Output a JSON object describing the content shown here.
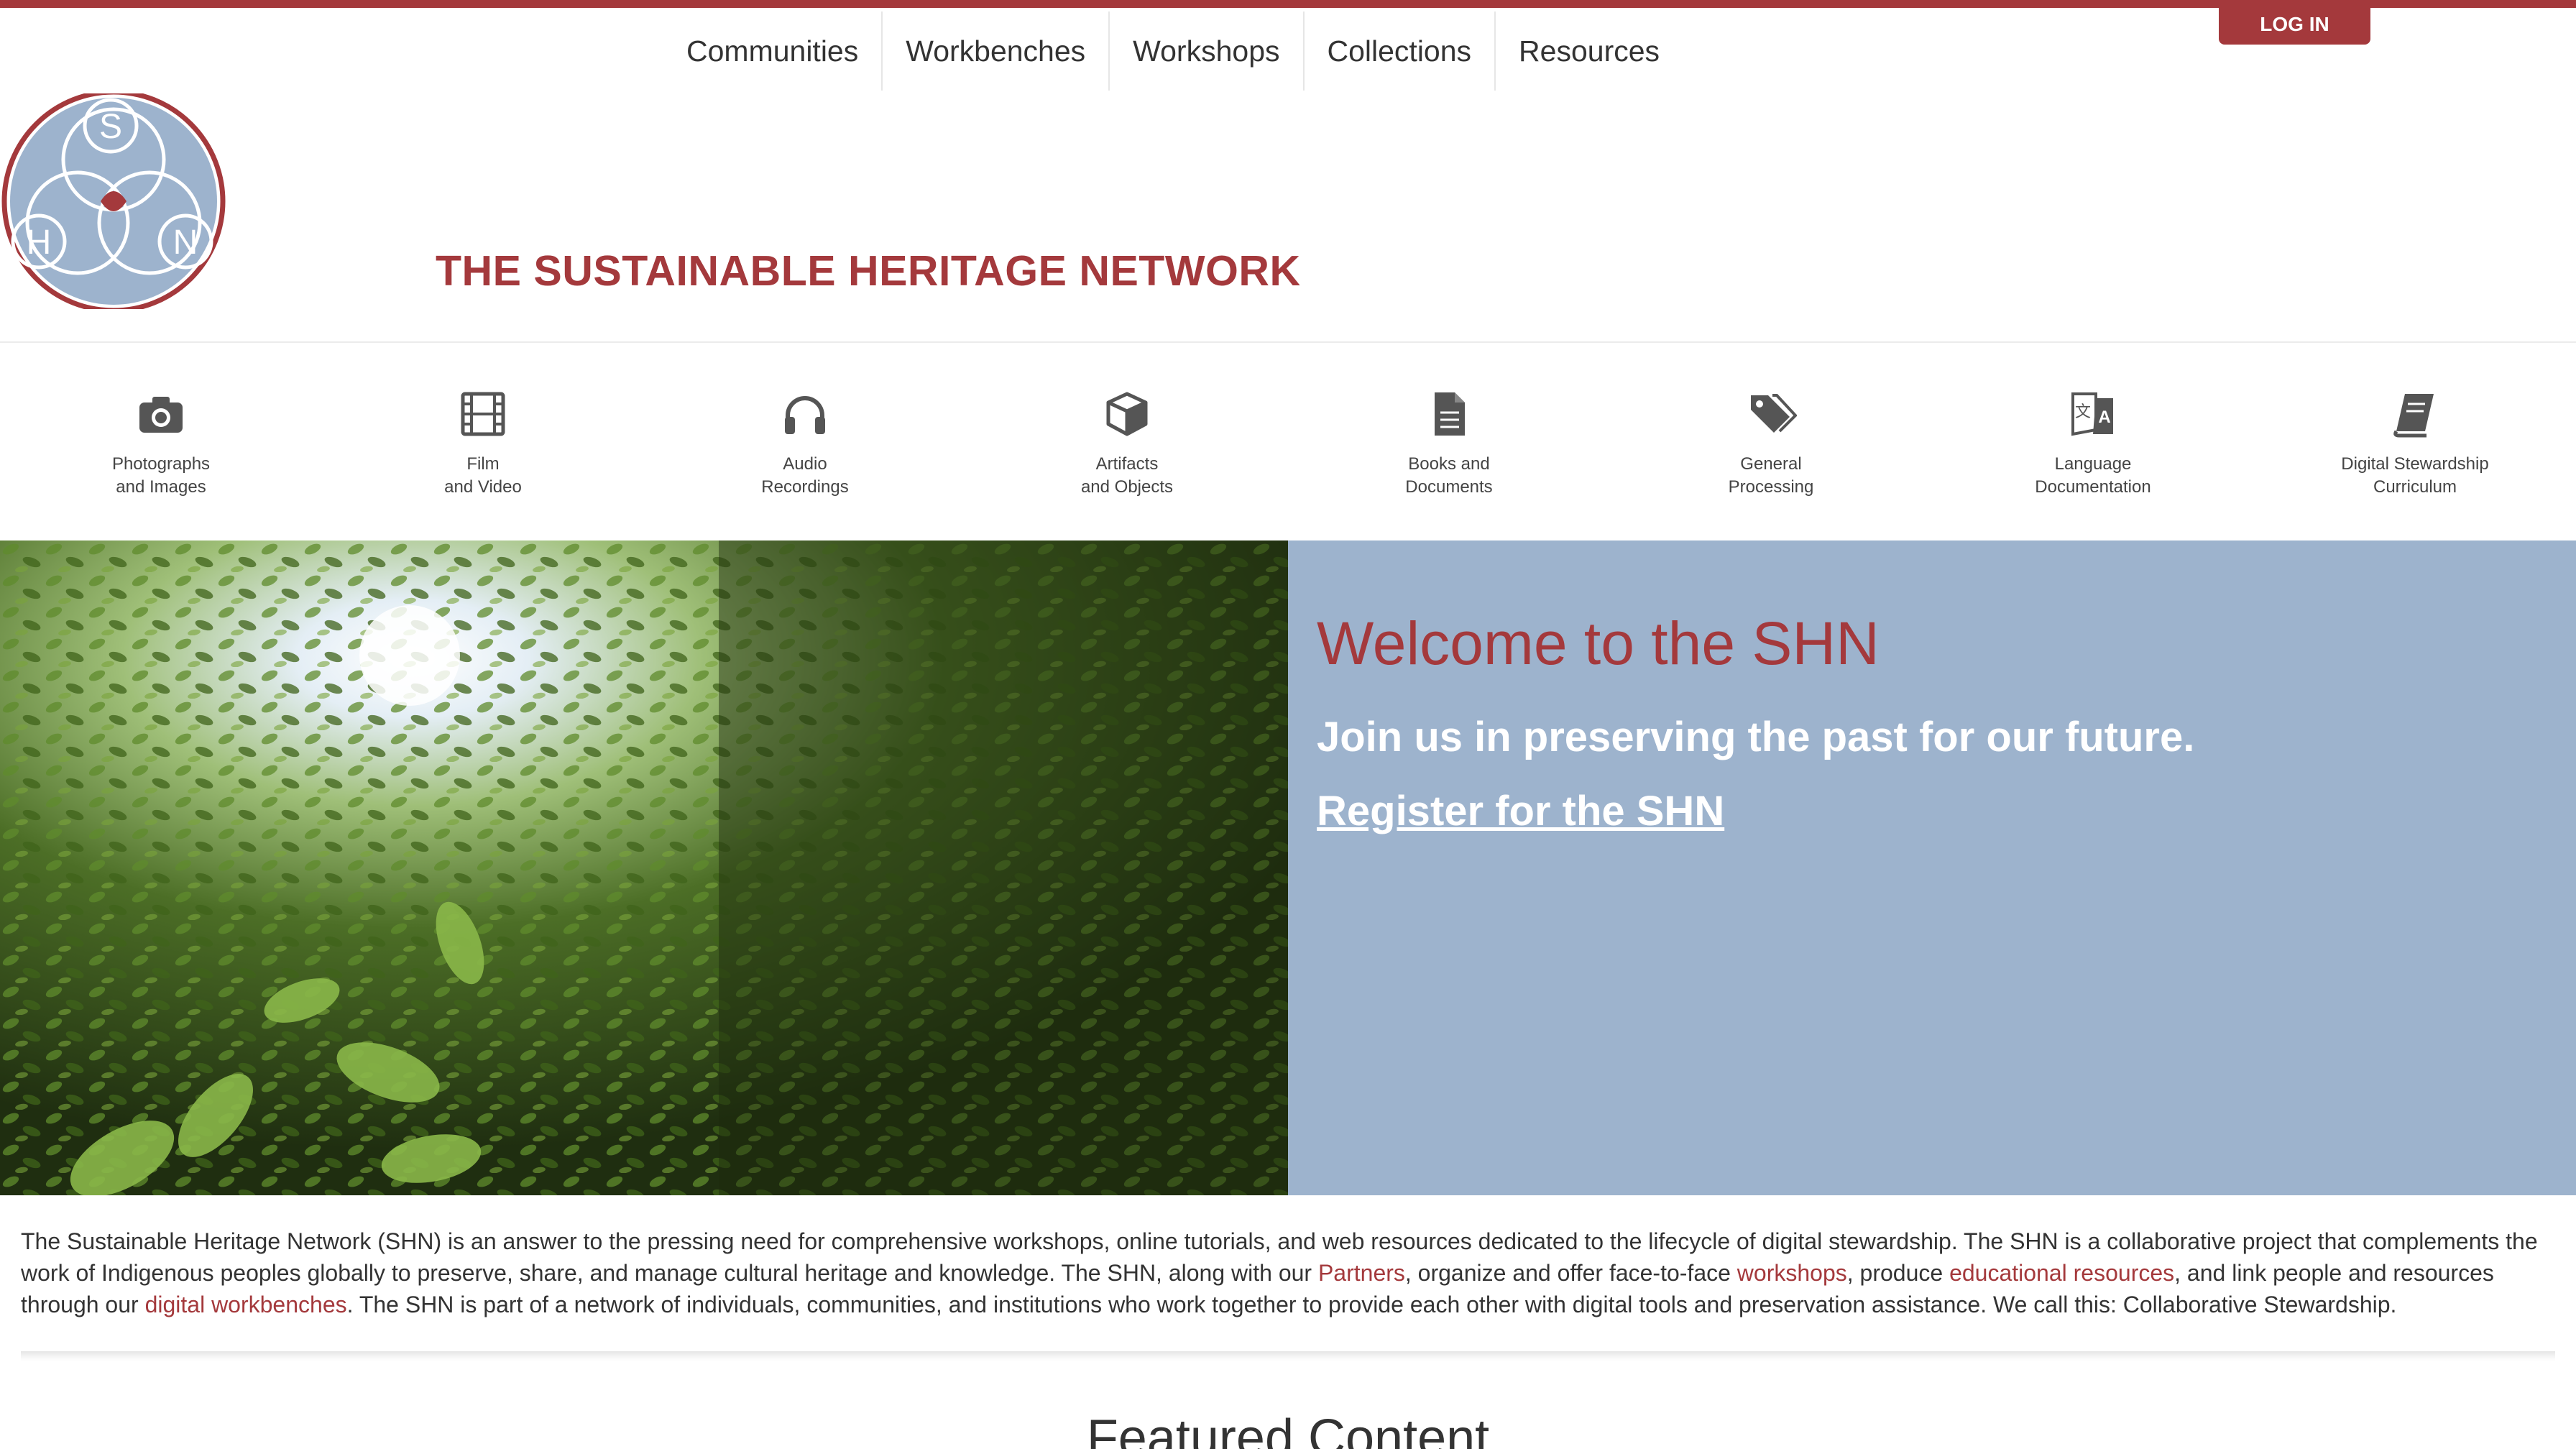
{
  "header": {
    "nav": [
      "Communities",
      "Workbenches",
      "Workshops",
      "Collections",
      "Resources"
    ],
    "login_label": "LOG IN",
    "site_title": "THE SUSTAINABLE HERITAGE NETWORK",
    "logo_letters": {
      "top": "S",
      "left": "H",
      "right": "N"
    }
  },
  "categories": [
    {
      "icon": "camera-icon",
      "line1": "Photographs",
      "line2": "and Images"
    },
    {
      "icon": "film-icon",
      "line1": "Film",
      "line2": "and Video"
    },
    {
      "icon": "headphones-icon",
      "line1": "Audio",
      "line2": "Recordings"
    },
    {
      "icon": "cube-icon",
      "line1": "Artifacts",
      "line2": "and Objects"
    },
    {
      "icon": "document-icon",
      "line1": "Books and",
      "line2": "Documents"
    },
    {
      "icon": "tags-icon",
      "line1": "General",
      "line2": "Processing"
    },
    {
      "icon": "translate-icon",
      "line1": "Language",
      "line2": "Documentation"
    },
    {
      "icon": "book-icon",
      "line1": "Digital Stewardship",
      "line2": "Curriculum"
    }
  ],
  "hero": {
    "welcome": "Welcome to the SHN",
    "tagline": "Join us in preserving the past for our future.",
    "register_link": "Register for the SHN"
  },
  "intro": {
    "p1": "The Sustainable Heritage Network (SHN) is an answer to the pressing need for comprehensive workshops, online tutorials, and web resources dedicated to the lifecycle of digital stewardship. The SHN is a collaborative project that complements the work of Indigenous peoples globally to preserve, share, and manage cultural heritage and knowledge. The SHN, along with our ",
    "link_partners": "Partners",
    "p2": ", organize and offer face-to-face ",
    "link_workshops": "workshops",
    "p3": ", produce ",
    "link_resources": "educational resources",
    "p4": ", and link people and resources through our ",
    "link_workbenches": "digital workbenches",
    "p5": ". The SHN is part of a network of individuals, communities, and institutions who work together to provide each other with digital tools and preservation assistance. We call this: Collaborative Stewardship."
  },
  "featured_heading": "Featured Content",
  "colors": {
    "brand": "#a4393c",
    "hero_panel": "#9db3cd",
    "logo_blue": "#9db3cd"
  }
}
